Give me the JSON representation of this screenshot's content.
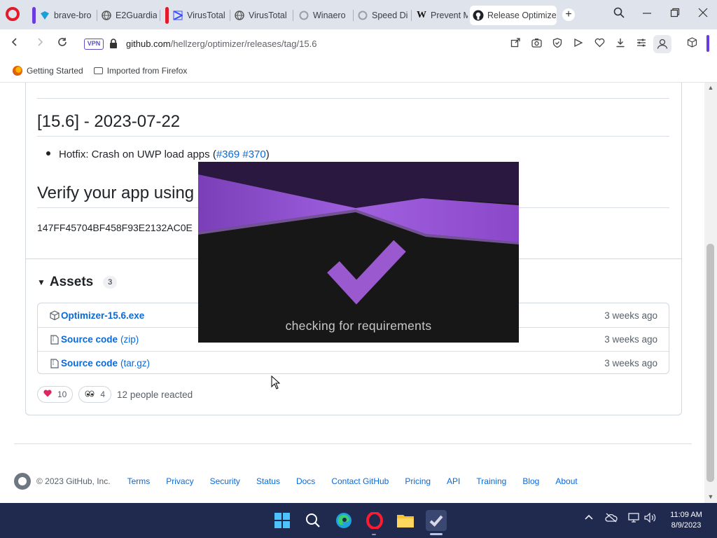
{
  "browser": {
    "tabs": [
      {
        "title": "brave-bro",
        "accent": "#6a3be0",
        "icon": "brave-download-icon",
        "active": false
      },
      {
        "title": "E2Guardia",
        "accent": "",
        "icon": "globe-icon",
        "active": false
      },
      {
        "title": "VirusTotal",
        "accent": "#e21b2b",
        "icon": "virustotal-icon",
        "active": false
      },
      {
        "title": "VirusTotal",
        "accent": "",
        "icon": "globe-icon",
        "active": false
      },
      {
        "title": "Winaero",
        "accent": "",
        "icon": "loading-icon",
        "active": false
      },
      {
        "title": "Speed Di",
        "accent": "",
        "icon": "loading-icon",
        "active": false
      },
      {
        "title": "Prevent M",
        "accent": "",
        "icon": "w-icon",
        "active": false
      },
      {
        "title": "Release Optimize",
        "accent": "",
        "icon": "github-icon",
        "active": true
      }
    ],
    "new_tab": "+",
    "address": {
      "vpn": "VPN",
      "host": "github.com",
      "path": "/hellzerg/optimizer/releases/tag/15.6"
    },
    "bookmarks": [
      {
        "label": "Getting Started",
        "icon": "firefox-icon"
      },
      {
        "label": "Imported from Firefox",
        "icon": "folder-icon"
      }
    ]
  },
  "release": {
    "version_heading": "[15.6] - 2023-07-22",
    "hotfix_text": "Hotfix: Crash on UWP load apps (",
    "hotfix_link1": "#369",
    "hotfix_link2": "#370",
    "hotfix_close": ")",
    "verify_heading": "Verify your app using",
    "hash_text": "147FF45704BF458F93E2132AC0E"
  },
  "assets": {
    "title": "Assets",
    "count": "3",
    "items": [
      {
        "name": "Optimizer-15.6.exe",
        "ext": "",
        "time": "3 weeks ago",
        "icon": "package-icon"
      },
      {
        "name": "Source code",
        "ext": "(zip)",
        "time": "3 weeks ago",
        "icon": "file-zip-icon"
      },
      {
        "name": "Source code",
        "ext": "(tar.gz)",
        "time": "3 weeks ago",
        "icon": "file-zip-icon"
      }
    ]
  },
  "reactions": {
    "heart_count": "10",
    "eyes_count": "4",
    "summary": "12 people reacted"
  },
  "splash": {
    "text": "checking for requirements",
    "accent": "#9b59d0"
  },
  "footer": {
    "copyright": "© 2023 GitHub, Inc.",
    "links": [
      "Terms",
      "Privacy",
      "Security",
      "Status",
      "Docs",
      "Contact GitHub",
      "Pricing",
      "API",
      "Training",
      "Blog",
      "About"
    ]
  },
  "taskbar": {
    "time": "11:09 AM",
    "date": "8/9/2023"
  }
}
